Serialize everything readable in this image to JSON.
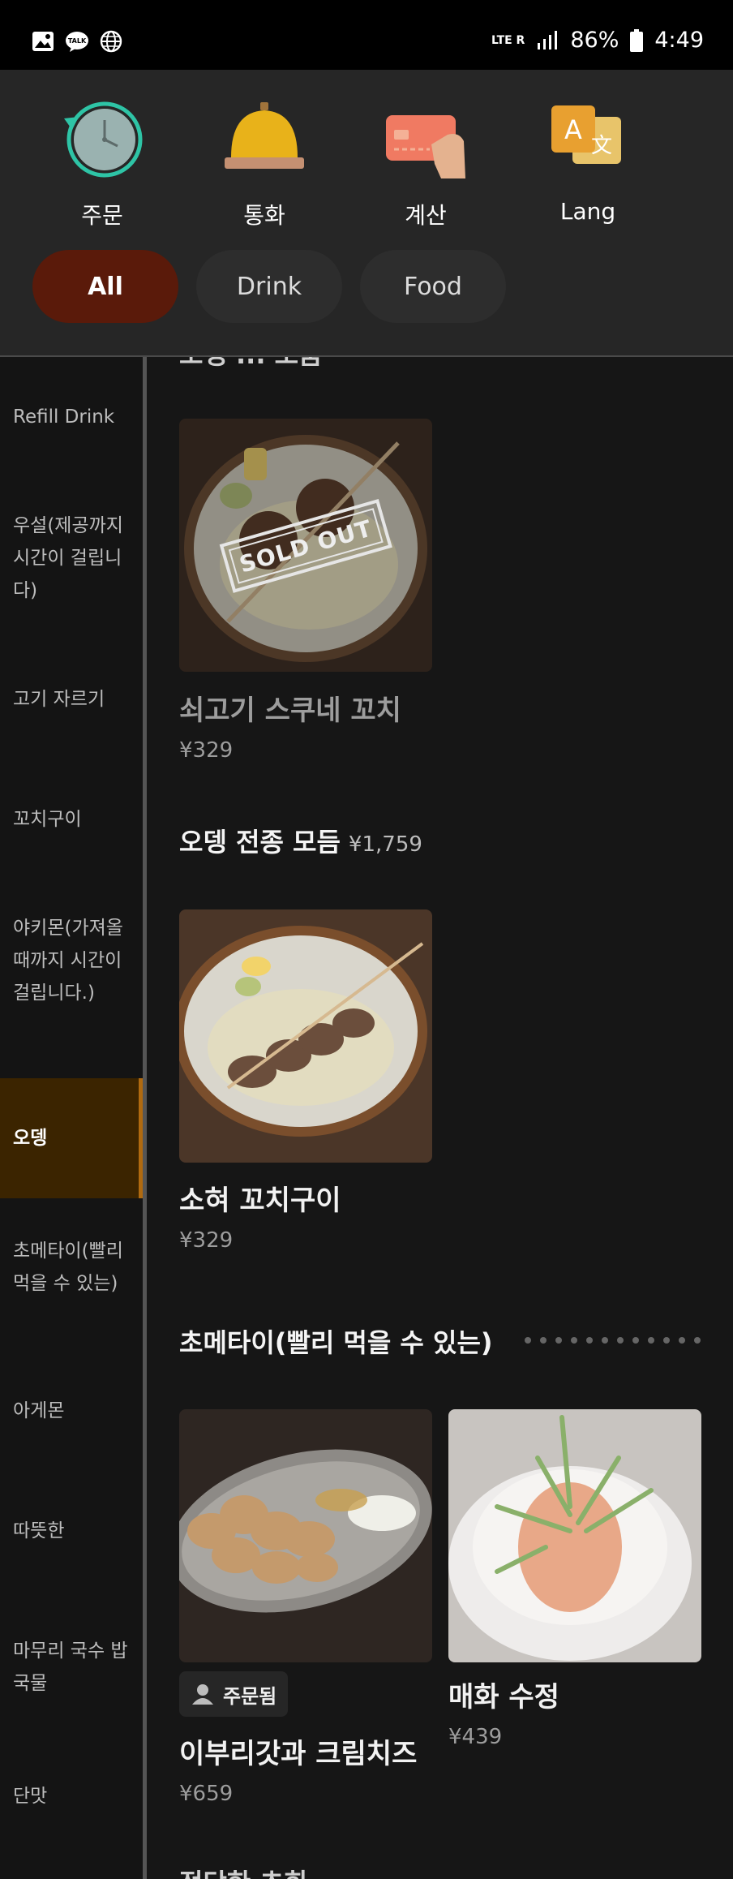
{
  "status_bar": {
    "network": "LTE R",
    "battery": "86%",
    "time": "4:49"
  },
  "top_nav": {
    "order": "주문",
    "call": "통화",
    "bill": "계산",
    "lang": "Lang"
  },
  "filters": {
    "all": "All",
    "drink": "Drink",
    "food": "Food"
  },
  "sidebar": [
    "Refill Drink",
    "우설(제공까지 시간이 걸립니다)",
    "고기 자르기",
    "꼬치구이",
    "야키몬(가져올 때까지 시간이 걸립니다.)",
    "오뎅",
    "초메타이(빨리 먹을 수 있는)",
    "아게몬",
    "따뜻한",
    "마무리 국수 밥 국물",
    "단맛"
  ],
  "content": {
    "partial_top_title": "오뎅 ... 모둠",
    "items": [
      {
        "name": "쇠고기 스쿠네 꼬치",
        "price": "¥329",
        "badge": "SOLD OUT"
      },
      {
        "name": "소혀 꼬치구이",
        "price": "¥329"
      },
      {
        "name": "이부리갓과 크림치즈",
        "price": "¥659",
        "orderer": "주문됨"
      },
      {
        "name": "매화 수정",
        "price": "¥439"
      }
    ],
    "sections": [
      {
        "title": "오뎅 전종 모듬",
        "price": "¥1,759"
      },
      {
        "title": "초메타이(빨리 먹을 수 있는)"
      }
    ],
    "partial_bottom_title": "적당한 초회"
  }
}
